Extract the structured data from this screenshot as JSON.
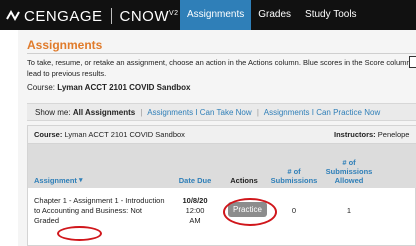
{
  "brand": {
    "name": "CENGAGE",
    "product": "CNOW",
    "version": "V2"
  },
  "nav": {
    "tabs": [
      "Assignments",
      "Grades",
      "Study Tools"
    ],
    "active": "Assignments"
  },
  "page": {
    "title": "Assignments",
    "instructions": "To take, resume, or retake an assignment, choose an action in the Actions column. Blue scores in the Score column lead to previous results.",
    "course_label": "Course:",
    "course_name": "Lyman ACCT 2101 COVID Sandbox"
  },
  "filters": {
    "label": "Show me:",
    "selected": "All Assignments",
    "links": [
      "Assignments I Can Take Now",
      "Assignments I Can Practice Now"
    ]
  },
  "table": {
    "course_label": "Course:",
    "course_name": "Lyman ACCT 2101 COVID Sandbox",
    "instructors_label": "Instructors:",
    "instructors_value": "Penelope",
    "headers": {
      "assignment": "Assignment",
      "date_due": "Date Due",
      "actions": "Actions",
      "submissions": "# of Submissions",
      "allowed": "# of Submissions Allowed"
    },
    "rows": [
      {
        "assignment": "Chapter 1 - Assignment 1 - Introduction to Accounting and Business",
        "status": "Not Graded",
        "date": "10/8/20",
        "time": "12:00",
        "ampm": "AM",
        "action": "Practice",
        "submissions": "0",
        "allowed": "1"
      }
    ]
  },
  "colors": {
    "accent": "#2f7fb8",
    "title": "#e07b2b",
    "annotation": "#d0161b",
    "topbar": "#111111"
  },
  "icons": {
    "logo": "cengage-logo-icon",
    "sort": "sort-down-icon"
  }
}
